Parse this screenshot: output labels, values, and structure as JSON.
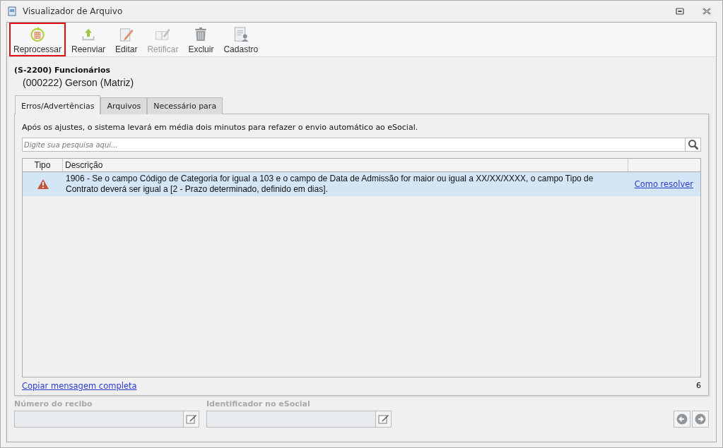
{
  "window": {
    "title": "Visualizador de Arquivo"
  },
  "toolbar": [
    {
      "label": "Reprocessar",
      "kind": "reprocess",
      "disabled": false,
      "selected": true
    },
    {
      "label": "Reenviar",
      "kind": "upload",
      "disabled": false,
      "selected": false
    },
    {
      "label": "Editar",
      "kind": "edit",
      "disabled": false,
      "selected": false
    },
    {
      "label": "Retificar",
      "kind": "rectify",
      "disabled": true,
      "selected": false
    },
    {
      "label": "Excluir",
      "kind": "delete",
      "disabled": false,
      "selected": false
    },
    {
      "label": "Cadastro",
      "kind": "register",
      "disabled": false,
      "selected": false
    }
  ],
  "header": {
    "event": "(S-2200) Funcionários",
    "subject": "(000222) Gerson (Matriz)"
  },
  "tabs": [
    {
      "label": "Erros/Advertências",
      "selected": true
    },
    {
      "label": "Arquivos",
      "selected": false
    },
    {
      "label": "Necessário para",
      "selected": false
    }
  ],
  "notice": "Após os ajustes, o sistema levará em média dois minutos para refazer o envio automático ao eSocial.",
  "search": {
    "placeholder": "Digite sua pesquisa aqui..."
  },
  "table": {
    "columns": [
      "Tipo",
      "Descrição"
    ],
    "rows": [
      {
        "kind": "error",
        "selected": true,
        "description": "1906 - Se o campo Código de Categoria for igual a 103 e o campo de Data de Admissão for maior ou igual a XX/XX/XXXX, o campo Tipo de Contrato deverá ser igual a [2 - Prazo determinado, definido em dias].",
        "action": "Como resolver"
      }
    ]
  },
  "footer": {
    "copy_link": "Copiar mensagem completa",
    "count": "6"
  },
  "fields": [
    {
      "label": "Número do recibo",
      "disabled": true
    },
    {
      "label": "Identificador no eSocial",
      "disabled": true
    }
  ]
}
